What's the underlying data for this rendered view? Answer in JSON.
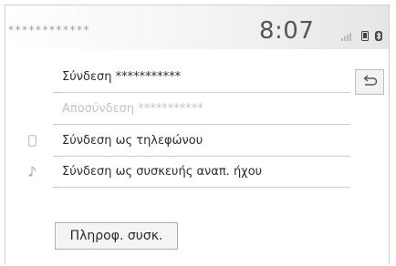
{
  "status_bar": {
    "device_name_masked": "************",
    "time": "8:07",
    "icons": [
      "signal-icon",
      "phone-icon",
      "bluetooth-icon"
    ]
  },
  "menu": {
    "items": [
      {
        "label": "Σύνδεση  ***********",
        "icon": null,
        "enabled": true
      },
      {
        "label": "Αποσύνδεση  ***********",
        "icon": null,
        "enabled": false
      },
      {
        "label": "Σύνδεση ως τηλεφώνου",
        "icon": "phone-icon",
        "enabled": true
      },
      {
        "label": "Σύνδεση ως συσκευής αναπ. ήχου",
        "icon": "music-note-icon",
        "enabled": true
      }
    ]
  },
  "back_button": {
    "icon": "back-arrow-icon"
  },
  "info_button": {
    "label": "Πληροφ. συσκ."
  },
  "colors": {
    "text": "#2b2b2b",
    "disabled": "#c4c4c4",
    "divider": "#cccccc"
  }
}
